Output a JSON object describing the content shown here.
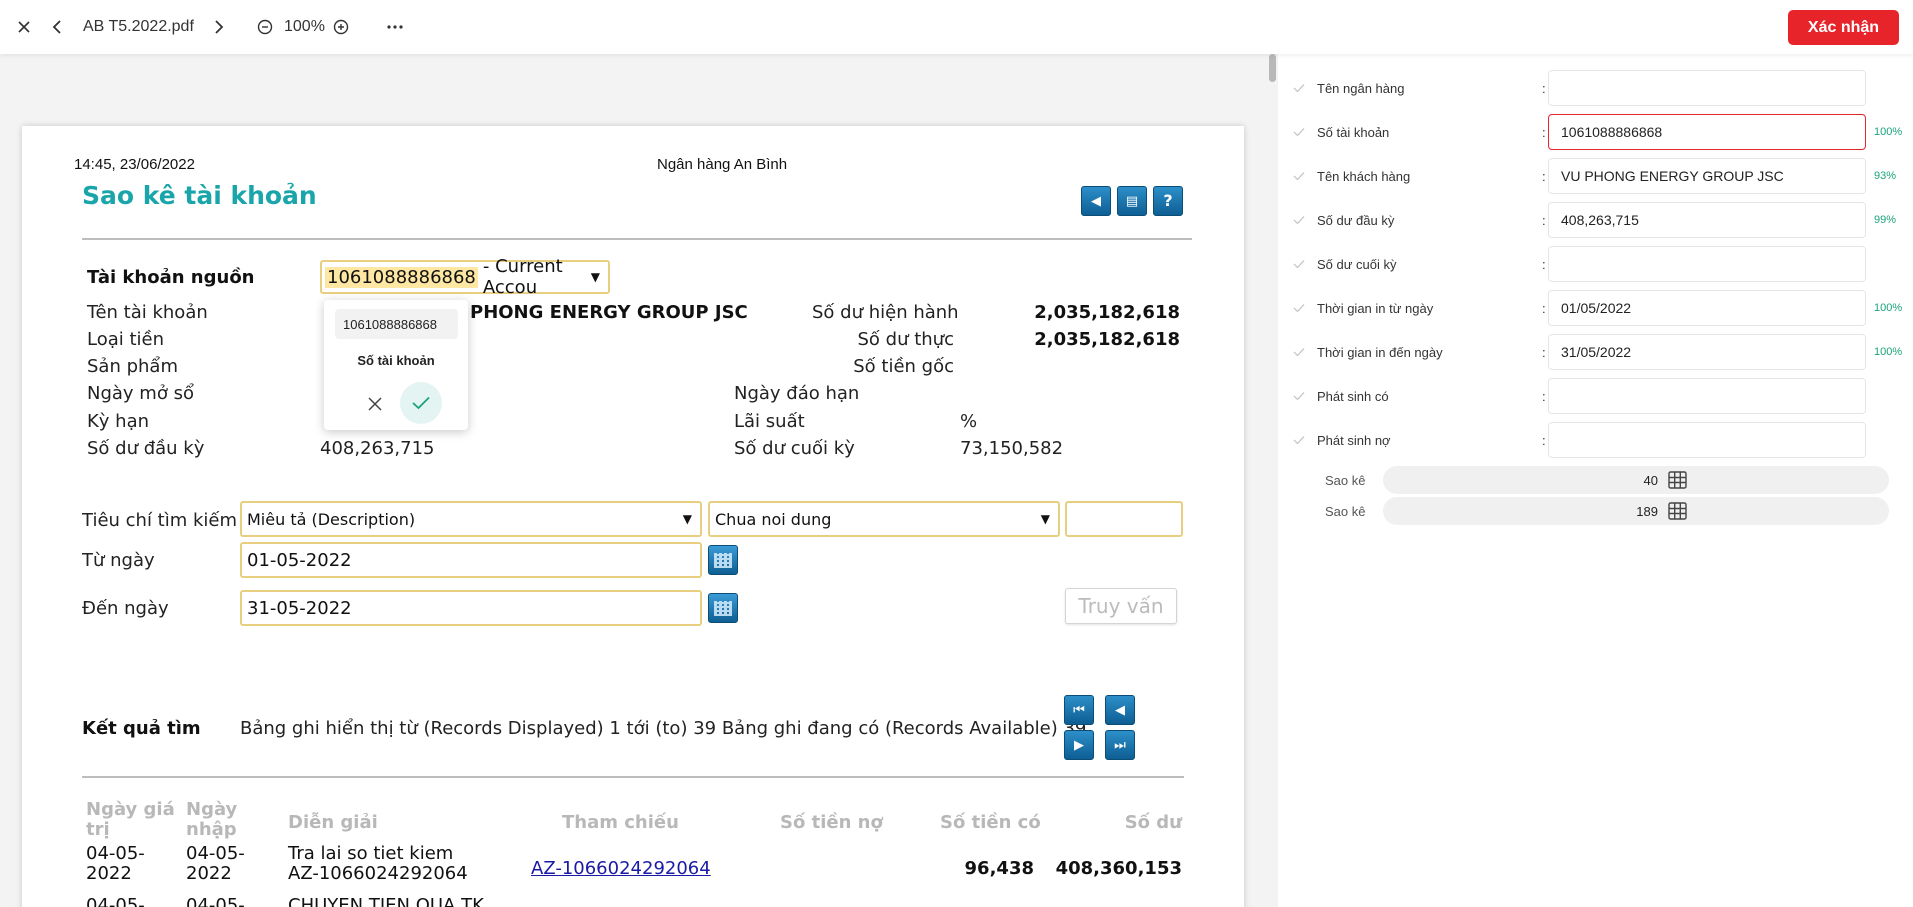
{
  "toolbar": {
    "file_name": "AB T5.2022.pdf",
    "zoom": "100%",
    "confirm_label": "Xác nhận"
  },
  "document": {
    "print_time": "14:45, 23/06/2022",
    "bank_name": "Ngân hàng An Bình",
    "title": "Sao kê tài khoản",
    "source_account_label": "Tài khoản nguồn",
    "source_account_highlight": "1061088886868",
    "source_account_suffix": "- Current Accou",
    "account_name_label": "Tên tài khoản",
    "account_name_value": "PHONG ENERGY GROUP JSC",
    "currency_label": "Loại tiền",
    "product_label": "Sản phẩm",
    "open_date_label": "Ngày mở sổ",
    "term_label": "Kỳ hạn",
    "opening_balance_label": "Số dư đầu kỳ",
    "opening_balance_value": "408,263,715",
    "current_balance_label": "Số dư hiện hành",
    "current_balance_value": "2,035,182,618",
    "actual_balance_label": "Số dư thực",
    "actual_balance_value": "2,035,182,618",
    "principal_label": "Số tiền gốc",
    "maturity_label": "Ngày đáo hạn",
    "interest_label": "Lãi suất",
    "interest_unit": "%",
    "closing_balance_label": "Số dư cuối kỳ",
    "closing_balance_value": "73,150,582",
    "search_criteria_label": "Tiêu chí tìm kiếm",
    "criteria_select": "Miêu tả (Description)",
    "content_select": "Chua noi dung",
    "from_date_label": "Từ ngày",
    "from_date_value": "01-05-2022",
    "to_date_label": "Đến ngày",
    "to_date_value": "31-05-2022",
    "query_button": "Truy vấn",
    "results_label": "Kết quả tìm",
    "records_text": "Bảng ghi hiển thị từ (Records Displayed) 1 tới (to) 39 Bảng ghi đang có (Records Available) 39",
    "table_headers": [
      "Ngày giá trị",
      "Ngày nhập",
      "Diễn giải",
      "Tham chiếu",
      "Số tiền nợ",
      "Số tiền có",
      "Số dư"
    ],
    "rows": [
      {
        "value_date": "04-05-2022",
        "entry_date": "04-05-2022",
        "description": "Tra lai so tiet kiem AZ-1066024292064",
        "reference": "AZ-1066024292064",
        "debit": "",
        "credit": "96,438",
        "balance": "408,360,153"
      },
      {
        "value_date": "04-05-",
        "entry_date": "04-05-",
        "description": "CHUYEN TIEN QUA TK",
        "reference": "",
        "debit": "",
        "credit": "",
        "balance": ""
      }
    ]
  },
  "popup": {
    "value": "1061088886868",
    "field_label": "Số tài khoản"
  },
  "fields": [
    {
      "label": "Tên ngân hàng",
      "value": "",
      "confidence": ""
    },
    {
      "label": "Số tài khoản",
      "value": "1061088886868",
      "confidence": "100%"
    },
    {
      "label": "Tên khách hàng",
      "value": "VU PHONG ENERGY GROUP JSC",
      "confidence": "93%"
    },
    {
      "label": "Số dư đầu kỳ",
      "value": "408,263,715",
      "confidence": "99%"
    },
    {
      "label": "Số dư cuối kỳ",
      "value": "",
      "confidence": ""
    },
    {
      "label": "Thời gian in từ ngày",
      "value": "01/05/2022",
      "confidence": "100%"
    },
    {
      "label": "Thời gian in đến ngày",
      "value": "31/05/2022",
      "confidence": "100%"
    },
    {
      "label": "Phát sinh có",
      "value": "",
      "confidence": ""
    },
    {
      "label": "Phát sinh nợ",
      "value": "",
      "confidence": ""
    }
  ],
  "statements": [
    {
      "label": "Sao kê",
      "count": "40"
    },
    {
      "label": "Sao kê",
      "count": "189"
    }
  ],
  "colors": {
    "accent": "#e8242b",
    "title_teal": "#19a5a9",
    "confidence_green": "#1aa37a"
  }
}
